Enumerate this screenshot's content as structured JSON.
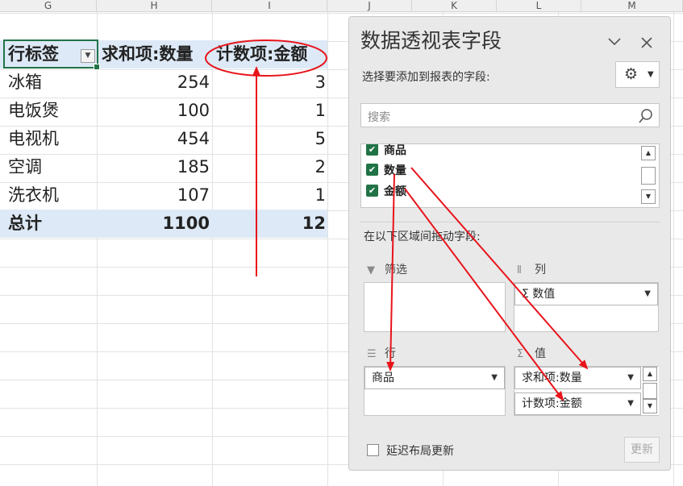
{
  "sheet": {
    "columns": [
      "G",
      "H",
      "I",
      "J",
      "K",
      "L",
      "M"
    ]
  },
  "pivot": {
    "header": {
      "row_label": "行标签",
      "sum_label": "求和项:数量",
      "count_label": "计数项:金额"
    },
    "rows": [
      {
        "label": "冰箱",
        "sum": "254",
        "count": "3"
      },
      {
        "label": "电饭煲",
        "sum": "100",
        "count": "1"
      },
      {
        "label": "电视机",
        "sum": "454",
        "count": "5"
      },
      {
        "label": "空调",
        "sum": "185",
        "count": "2"
      },
      {
        "label": "洗衣机",
        "sum": "107",
        "count": "1"
      }
    ],
    "total": {
      "label": "总计",
      "sum": "1100",
      "count": "12"
    }
  },
  "pane": {
    "title": "数据透视表字段",
    "subtitle": "选择要添加到报表的字段:",
    "search_placeholder": "搜索",
    "fields": [
      {
        "name": "商品",
        "checked": true
      },
      {
        "name": "数量",
        "checked": true
      },
      {
        "name": "金额",
        "checked": true
      }
    ],
    "drag_label": "在以下区域间拖动字段:",
    "areas": {
      "filter": {
        "title": "筛选"
      },
      "columns": {
        "title": "列",
        "items": [
          "Σ 数值"
        ]
      },
      "rows": {
        "title": "行",
        "items": [
          "商品"
        ]
      },
      "values": {
        "title": "值",
        "items": [
          "求和项:数量",
          "计数项:金额"
        ]
      }
    },
    "defer_label": "延迟布局更新",
    "update_label": "更新"
  },
  "colors": {
    "pivot_header_bg": "#dde9f6",
    "selection": "#217346",
    "checkbox": "#217346",
    "annotation": "#e8141b"
  },
  "icons": [
    "filter-dropdown-icon",
    "minimize-chevron-icon",
    "close-icon",
    "gear-icon",
    "search-icon",
    "checkbox-checked-icon",
    "filter-funnel-icon",
    "columns-icon",
    "rows-icon",
    "sigma-icon"
  ]
}
